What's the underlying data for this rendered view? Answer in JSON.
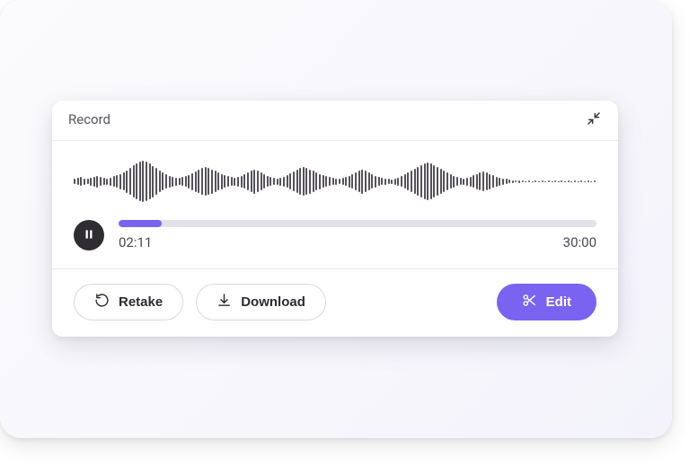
{
  "header": {
    "title": "Record"
  },
  "player": {
    "elapsed": "02:11",
    "total": "30:00",
    "progress_percent": 9,
    "waveform_heights": [
      6,
      8,
      10,
      7,
      6,
      9,
      11,
      13,
      10,
      8,
      7,
      9,
      12,
      14,
      17,
      20,
      25,
      30,
      36,
      40,
      44,
      46,
      44,
      40,
      35,
      30,
      24,
      20,
      16,
      13,
      11,
      9,
      8,
      10,
      12,
      15,
      19,
      23,
      26,
      30,
      32,
      30,
      27,
      24,
      20,
      17,
      14,
      12,
      10,
      9,
      11,
      13,
      16,
      20,
      24,
      27,
      24,
      20,
      16,
      12,
      10,
      8,
      7,
      9,
      11,
      14,
      18,
      22,
      26,
      30,
      32,
      30,
      27,
      24,
      20,
      17,
      14,
      12,
      10,
      8,
      7,
      6,
      8,
      10,
      13,
      16,
      20,
      24,
      27,
      24,
      20,
      16,
      13,
      10,
      8,
      7,
      6,
      5,
      7,
      9,
      12,
      16,
      20,
      24,
      28,
      32,
      36,
      40,
      42,
      40,
      36,
      32,
      28,
      24,
      20,
      16,
      13,
      10,
      8,
      7,
      9,
      11,
      14,
      17,
      20,
      22,
      20,
      17,
      14,
      11,
      9,
      7,
      6,
      4,
      3,
      2,
      3,
      2,
      1,
      2,
      1,
      2,
      1,
      2,
      1,
      2,
      1,
      2,
      1,
      2,
      1,
      2,
      1,
      2,
      1,
      2,
      1,
      2,
      1,
      2
    ]
  },
  "actions": {
    "retake_label": "Retake",
    "download_label": "Download",
    "edit_label": "Edit"
  },
  "colors": {
    "accent": "#7a63f0"
  }
}
